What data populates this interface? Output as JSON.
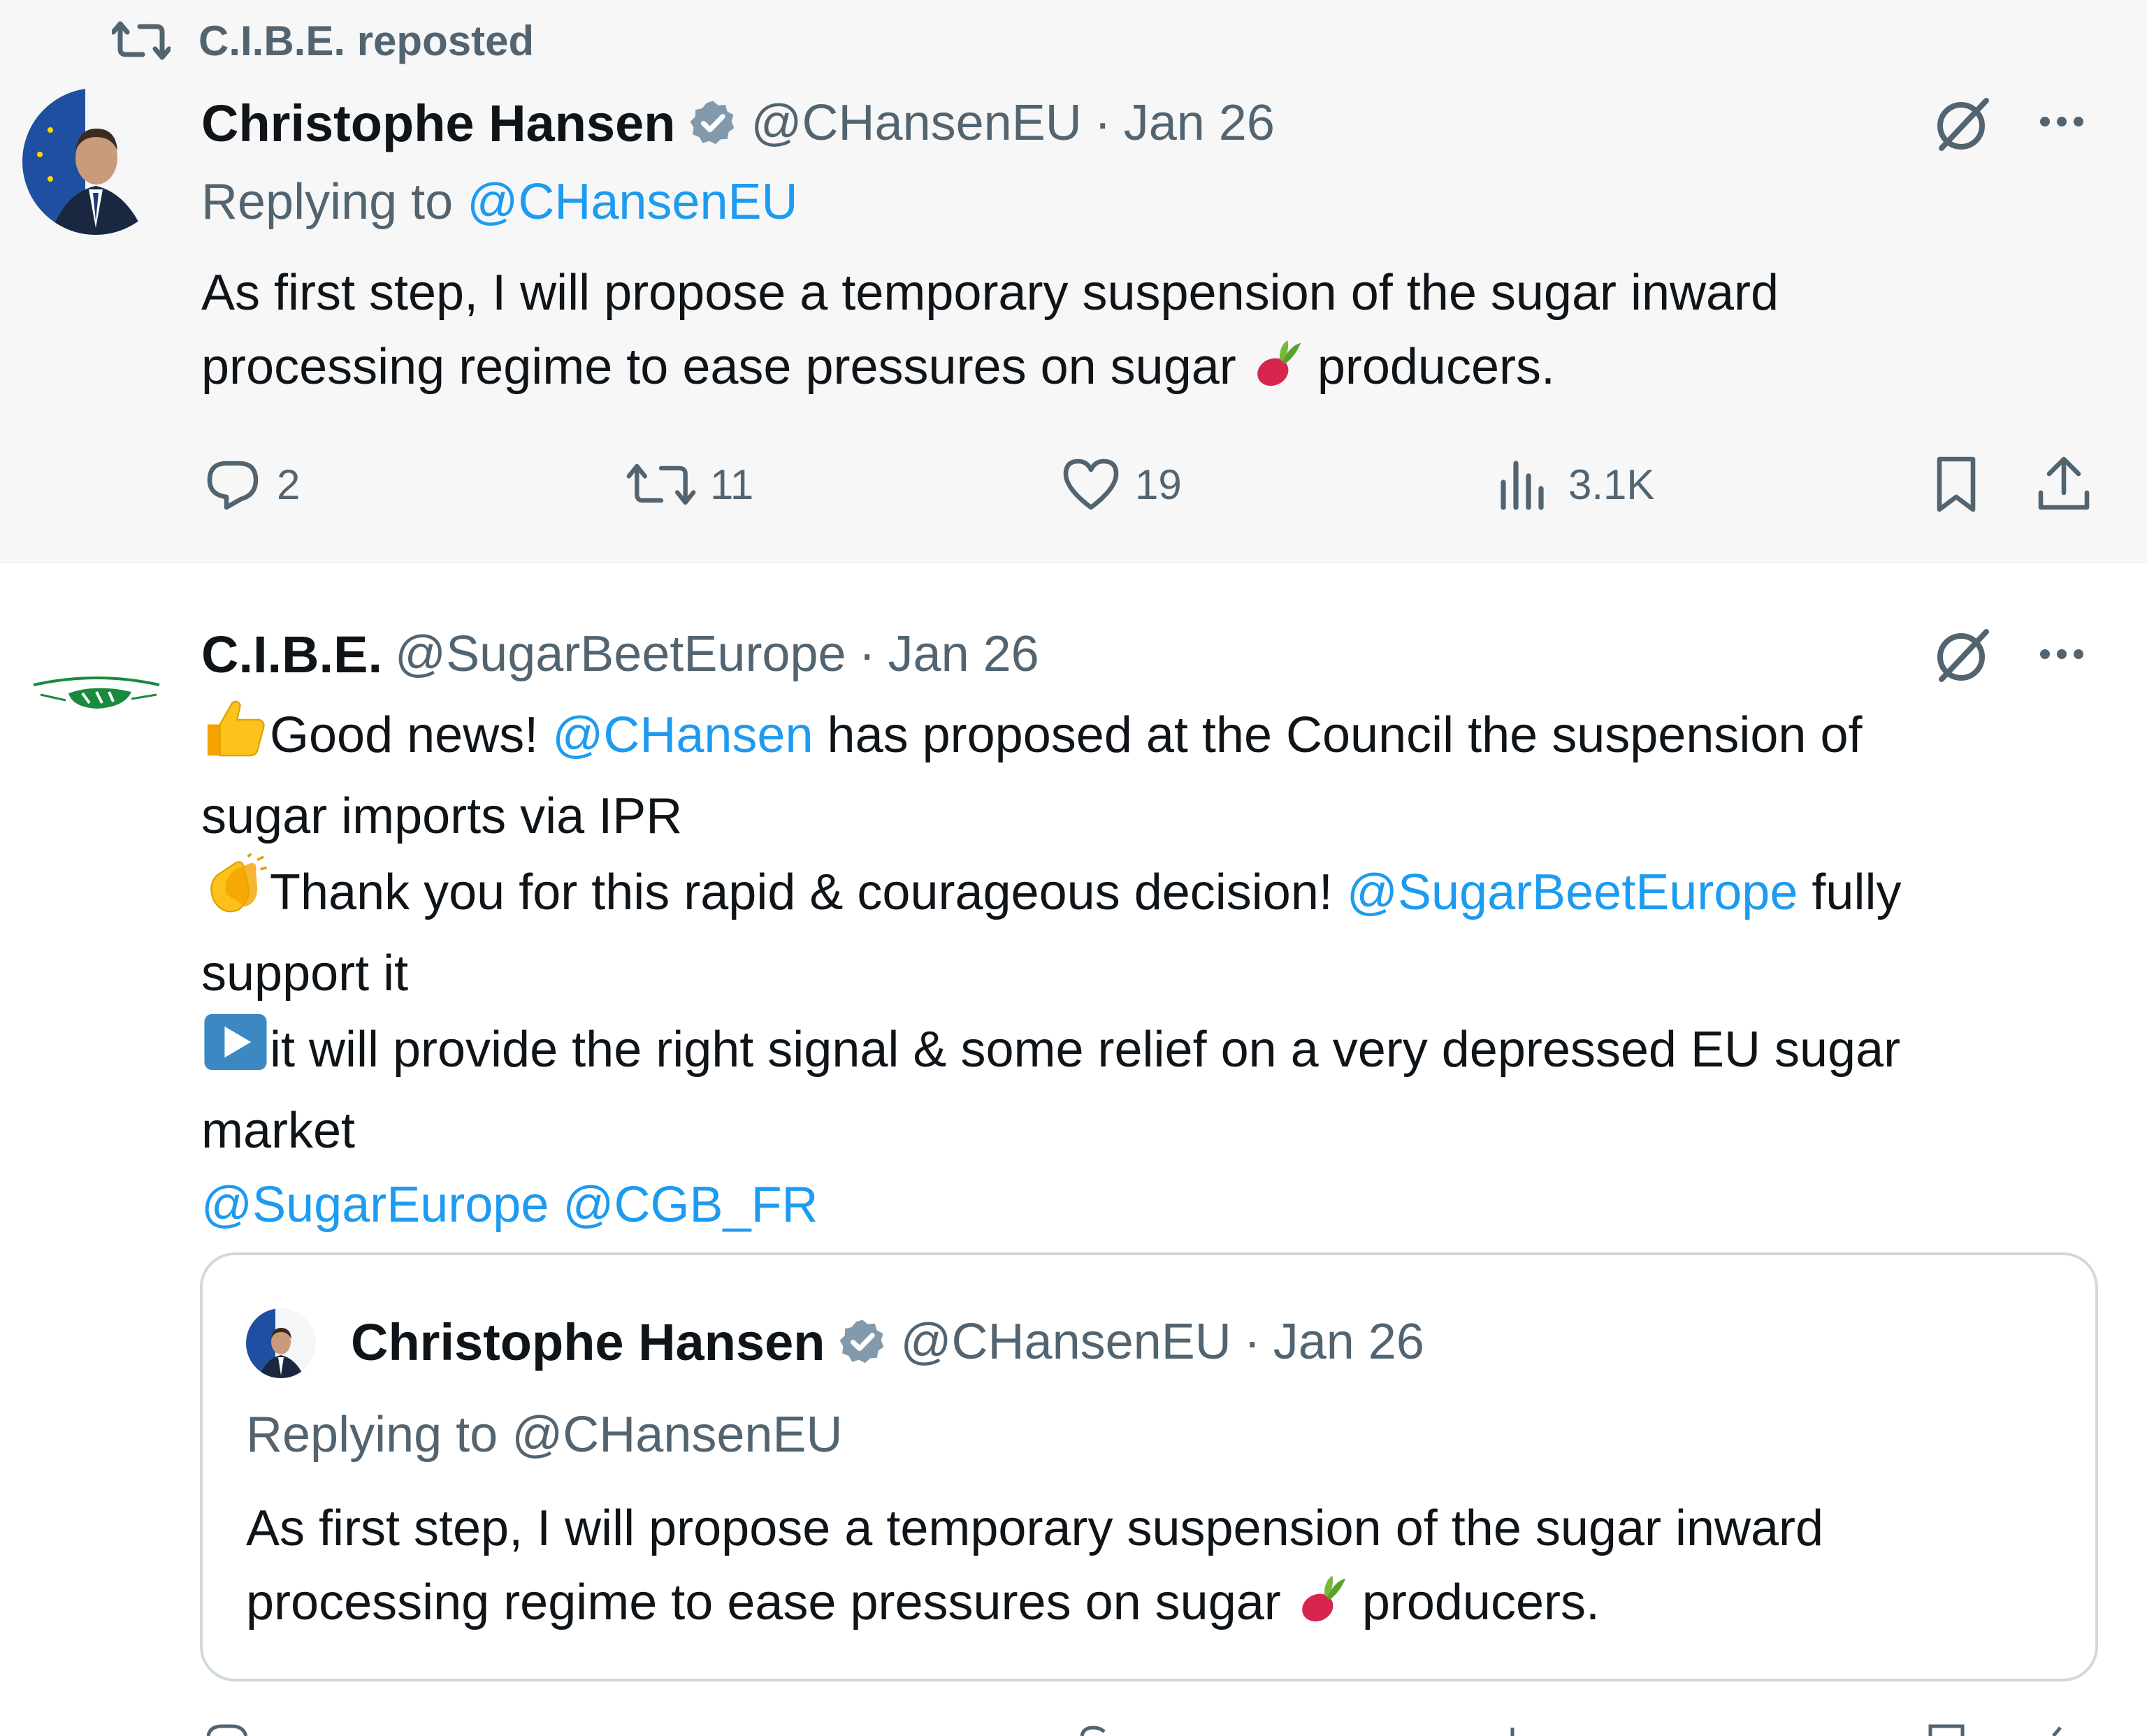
{
  "repost": {
    "text": "C.I.B.E. reposted",
    "icon": "repost-icon"
  },
  "tweet1": {
    "author_name": "Christophe Hansen",
    "handle": "@CHansenEU",
    "separator": "·",
    "date": "Jan 26",
    "replying_prefix": "Replying to",
    "replying_handle": "@CHansenEU",
    "text_line1": "As first step, I will propose a temporary suspension of the sugar inward",
    "text_line2_a": "processing regime to ease pressures on sugar",
    "text_line2_b": "producers.",
    "actions": {
      "replies": "2",
      "reposts": "11",
      "likes": "19",
      "views": "3.1K"
    }
  },
  "tweet2": {
    "author_name": "C.I.B.E.",
    "handle": "@SugarBeetEurope",
    "separator": "·",
    "date": "Jan 26",
    "line1_a": "Good news!",
    "line1_mention": "@CHansen",
    "line1_b": "has proposed at the Council the suspension of",
    "line2": "sugar imports via IPR",
    "line3_a": "Thank you for this rapid & courageous decision!",
    "line3_mention": "@SugarBeetEurope",
    "line3_b": "fully",
    "line4": "support it",
    "line5": "it will provide the right signal & some relief on a very depressed EU sugar",
    "line6": "market",
    "mention_a": "@SugarEurope",
    "mention_b": "@CGB_FR"
  },
  "quote": {
    "author_name": "Christophe Hansen",
    "handle": "@CHansenEU",
    "separator": "·",
    "date": "Jan 26",
    "replying": "Replying to @CHansenEU",
    "text_line1": "As first step, I will propose a temporary suspension of the sugar inward",
    "text_line2_a": "processing regime to ease pressures on sugar",
    "text_line2_b": "producers."
  },
  "colors": {
    "link": "#1d9bf0",
    "muted": "#536471",
    "verified": "#829aab",
    "text": "#0f1419"
  }
}
